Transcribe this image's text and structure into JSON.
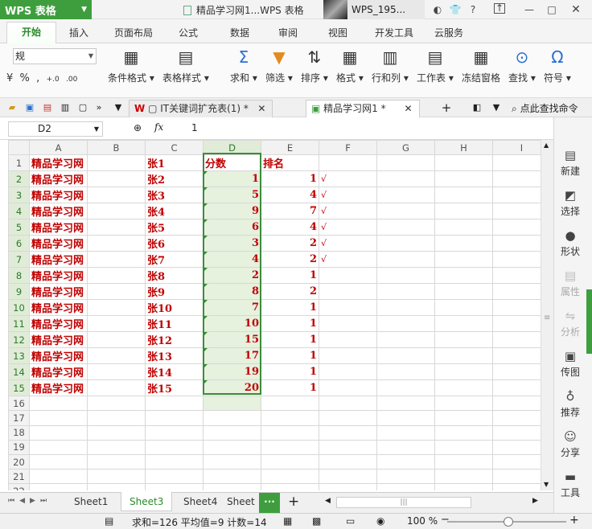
{
  "app": {
    "name": "WPS 表格",
    "doc_title": "精品学习网1...WPS 表格",
    "user": "WPS_195..."
  },
  "ribbon_tabs": [
    "开始",
    "插入",
    "页面布局",
    "公式",
    "数据",
    "审阅",
    "视图",
    "开发工具",
    "云服务"
  ],
  "ribbon": {
    "font_name": "规",
    "buttons": [
      "条件格式",
      "表格样式",
      "求和",
      "筛选",
      "排序",
      "格式",
      "行和列",
      "工作表",
      "冻结窗格",
      "查找",
      "符号"
    ]
  },
  "doc_tabs": [
    {
      "label": "IT关键词扩充表(1) *"
    },
    {
      "label": "精品学习网1 *"
    }
  ],
  "search_label": "点此查找命令",
  "formula_bar": {
    "cell_ref": "D2",
    "fx": "fx",
    "value": "1"
  },
  "columns": [
    "A",
    "B",
    "C",
    "D",
    "E",
    "F",
    "G",
    "H",
    "I"
  ],
  "rows": [
    {
      "n": "1",
      "a": "精品学习网",
      "c": "张1",
      "d": "分数",
      "e": "排名",
      "f": ""
    },
    {
      "n": "2",
      "a": "精品学习网",
      "c": "张2",
      "d": "1",
      "e": "1",
      "f": "√"
    },
    {
      "n": "3",
      "a": "精品学习网",
      "c": "张3",
      "d": "5",
      "e": "4",
      "f": "√"
    },
    {
      "n": "4",
      "a": "精品学习网",
      "c": "张4",
      "d": "9",
      "e": "7",
      "f": "√"
    },
    {
      "n": "5",
      "a": "精品学习网",
      "c": "张5",
      "d": "6",
      "e": "4",
      "f": "√"
    },
    {
      "n": "6",
      "a": "精品学习网",
      "c": "张6",
      "d": "3",
      "e": "2",
      "f": "√"
    },
    {
      "n": "7",
      "a": "精品学习网",
      "c": "张7",
      "d": "4",
      "e": "2",
      "f": "√"
    },
    {
      "n": "8",
      "a": "精品学习网",
      "c": "张8",
      "d": "2",
      "e": "1",
      "f": ""
    },
    {
      "n": "9",
      "a": "精品学习网",
      "c": "张9",
      "d": "8",
      "e": "2",
      "f": ""
    },
    {
      "n": "10",
      "a": "精品学习网",
      "c": "张10",
      "d": "7",
      "e": "1",
      "f": ""
    },
    {
      "n": "11",
      "a": "精品学习网",
      "c": "张11",
      "d": "10",
      "e": "1",
      "f": ""
    },
    {
      "n": "12",
      "a": "精品学习网",
      "c": "张12",
      "d": "15",
      "e": "1",
      "f": ""
    },
    {
      "n": "13",
      "a": "精品学习网",
      "c": "张13",
      "d": "17",
      "e": "1",
      "f": ""
    },
    {
      "n": "14",
      "a": "精品学习网",
      "c": "张14",
      "d": "19",
      "e": "1",
      "f": ""
    },
    {
      "n": "15",
      "a": "精品学习网",
      "c": "张15",
      "d": "20",
      "e": "1",
      "f": ""
    },
    {
      "n": "16",
      "a": "",
      "c": "",
      "d": "",
      "e": "",
      "f": ""
    },
    {
      "n": "17",
      "a": "",
      "c": "",
      "d": "",
      "e": "",
      "f": ""
    },
    {
      "n": "18",
      "a": "",
      "c": "",
      "d": "",
      "e": "",
      "f": ""
    },
    {
      "n": "19",
      "a": "",
      "c": "",
      "d": "",
      "e": "",
      "f": ""
    },
    {
      "n": "20",
      "a": "",
      "c": "",
      "d": "",
      "e": "",
      "f": ""
    },
    {
      "n": "21",
      "a": "",
      "c": "",
      "d": "",
      "e": "",
      "f": ""
    },
    {
      "n": "22",
      "a": "",
      "c": "",
      "d": "",
      "e": "",
      "f": ""
    },
    {
      "n": "23",
      "a": "",
      "c": "",
      "d": "",
      "e": "",
      "f": ""
    }
  ],
  "right_panel": [
    "新建",
    "选择",
    "形状",
    "属性",
    "分析",
    "传图",
    "推荐",
    "分享",
    "工具"
  ],
  "sheet_tabs": [
    "Sheet1",
    "Sheet3",
    "Sheet4",
    "Sheet"
  ],
  "more_tabs": "···",
  "status": {
    "stats": "求和=126  平均值=9  计数=14",
    "zoom": "100 %"
  },
  "colors": {
    "accent": "#3e9e3e",
    "cell_text": "#c00000",
    "selection_fill": "#e6f1de"
  }
}
